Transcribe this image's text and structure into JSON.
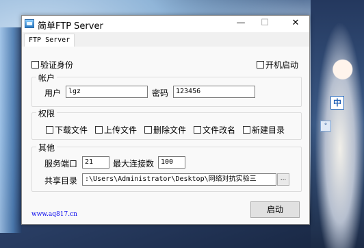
{
  "window": {
    "title": "简单FTP Server",
    "min_glyph": "—",
    "max_glyph": "☐",
    "close_glyph": "✕"
  },
  "tabs": [
    {
      "label": "FTP Server"
    }
  ],
  "options": {
    "auth_label": "验证身份",
    "auth_checked": false,
    "autostart_label": "开机启动",
    "autostart_checked": false
  },
  "account": {
    "title": "帐户",
    "user_label": "用户",
    "user_value": "lgz",
    "password_label": "密码",
    "password_value": "123456"
  },
  "permissions": {
    "title": "权限",
    "items": [
      {
        "label": "下载文件",
        "checked": false
      },
      {
        "label": "上传文件",
        "checked": false
      },
      {
        "label": "删除文件",
        "checked": false
      },
      {
        "label": "文件改名",
        "checked": false
      },
      {
        "label": "新建目录",
        "checked": false
      }
    ]
  },
  "other": {
    "title": "其他",
    "port_label": "服务端口",
    "port_value": "21",
    "maxconn_label": "最大连接数",
    "maxconn_value": "100",
    "share_label": "共享目录",
    "share_value": ":\\Users\\Administrator\\Desktop\\网络对抗实验三",
    "browse_label": "..."
  },
  "footer": {
    "link_text": "www.aq817.cn",
    "start_label": "启动"
  },
  "desktop": {
    "badge_text": "中"
  }
}
